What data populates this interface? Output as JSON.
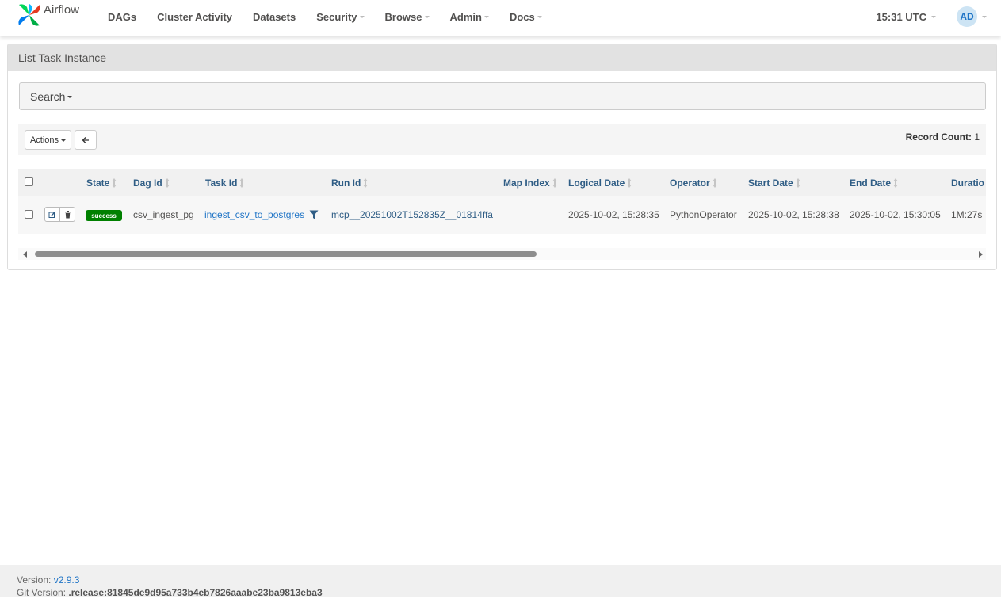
{
  "nav": {
    "brand": "Airflow",
    "items": [
      {
        "label": "DAGs",
        "dropdown": false
      },
      {
        "label": "Cluster Activity",
        "dropdown": false
      },
      {
        "label": "Datasets",
        "dropdown": false
      },
      {
        "label": "Security",
        "dropdown": true
      },
      {
        "label": "Browse",
        "dropdown": true
      },
      {
        "label": "Admin",
        "dropdown": true
      },
      {
        "label": "Docs",
        "dropdown": true
      }
    ],
    "clock": "15:31 UTC",
    "avatar_initials": "AD"
  },
  "panel": {
    "title": "List Task Instance",
    "search_label": "Search",
    "actions_label": "Actions",
    "record_count_label": "Record Count:",
    "record_count": "1"
  },
  "table": {
    "columns": [
      "State",
      "Dag Id",
      "Task Id",
      "Run Id",
      "Map Index",
      "Logical Date",
      "Operator",
      "Start Date",
      "End Date",
      "Duratio"
    ],
    "rows": [
      {
        "state": "success",
        "dag_id": "csv_ingest_pg",
        "task_id": "ingest_csv_to_postgres",
        "run_id": "mcp__20251002T152835Z__01814ffa",
        "map_index": "",
        "logical_date": "2025-10-02, 15:28:35",
        "operator": "PythonOperator",
        "start_date": "2025-10-02, 15:28:38",
        "end_date": "2025-10-02, 15:30:05",
        "duration": "1M:27s"
      }
    ]
  },
  "footer": {
    "version_label": "Version:",
    "version": "v2.9.3",
    "git_label": "Git Version:",
    "git_version": ".release:81845de9d95a733b4eb7826aaabe23ba9813eba3"
  },
  "colors": {
    "success": "#008000",
    "link": "#1f74c6",
    "header_text": "#2f5d85"
  },
  "scroll": {
    "horizontal_visible_fraction": 0.52,
    "horizontal_position_fraction": 0
  }
}
